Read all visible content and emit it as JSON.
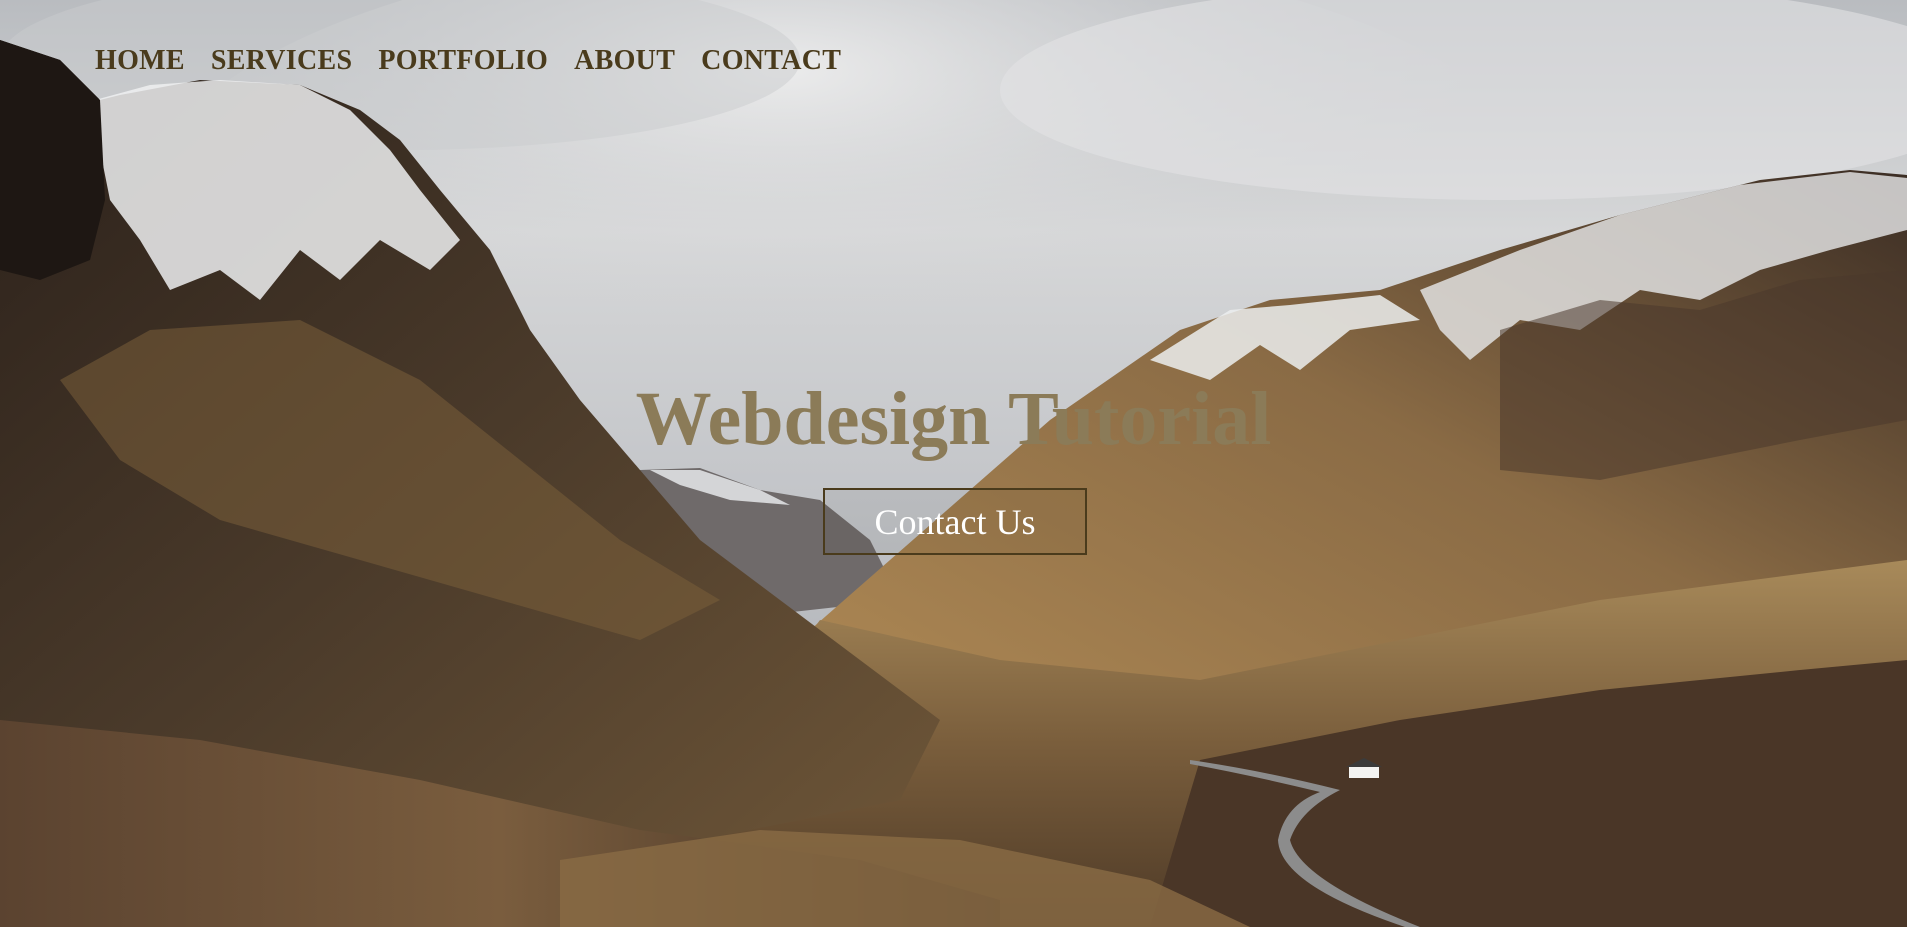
{
  "nav": {
    "items": [
      {
        "label": "HOME"
      },
      {
        "label": "SERVICES"
      },
      {
        "label": "PORTFOLIO"
      },
      {
        "label": "ABOUT"
      },
      {
        "label": "CONTACT"
      }
    ]
  },
  "hero": {
    "title": "Webdesign Tutorial",
    "cta_label": "Contact Us",
    "background": "mountain-valley-photo"
  },
  "colors": {
    "nav_text": "#4a3b1c",
    "title_text": "#8b7b58",
    "button_border": "#4a3b1c",
    "button_text": "#ffffff"
  }
}
